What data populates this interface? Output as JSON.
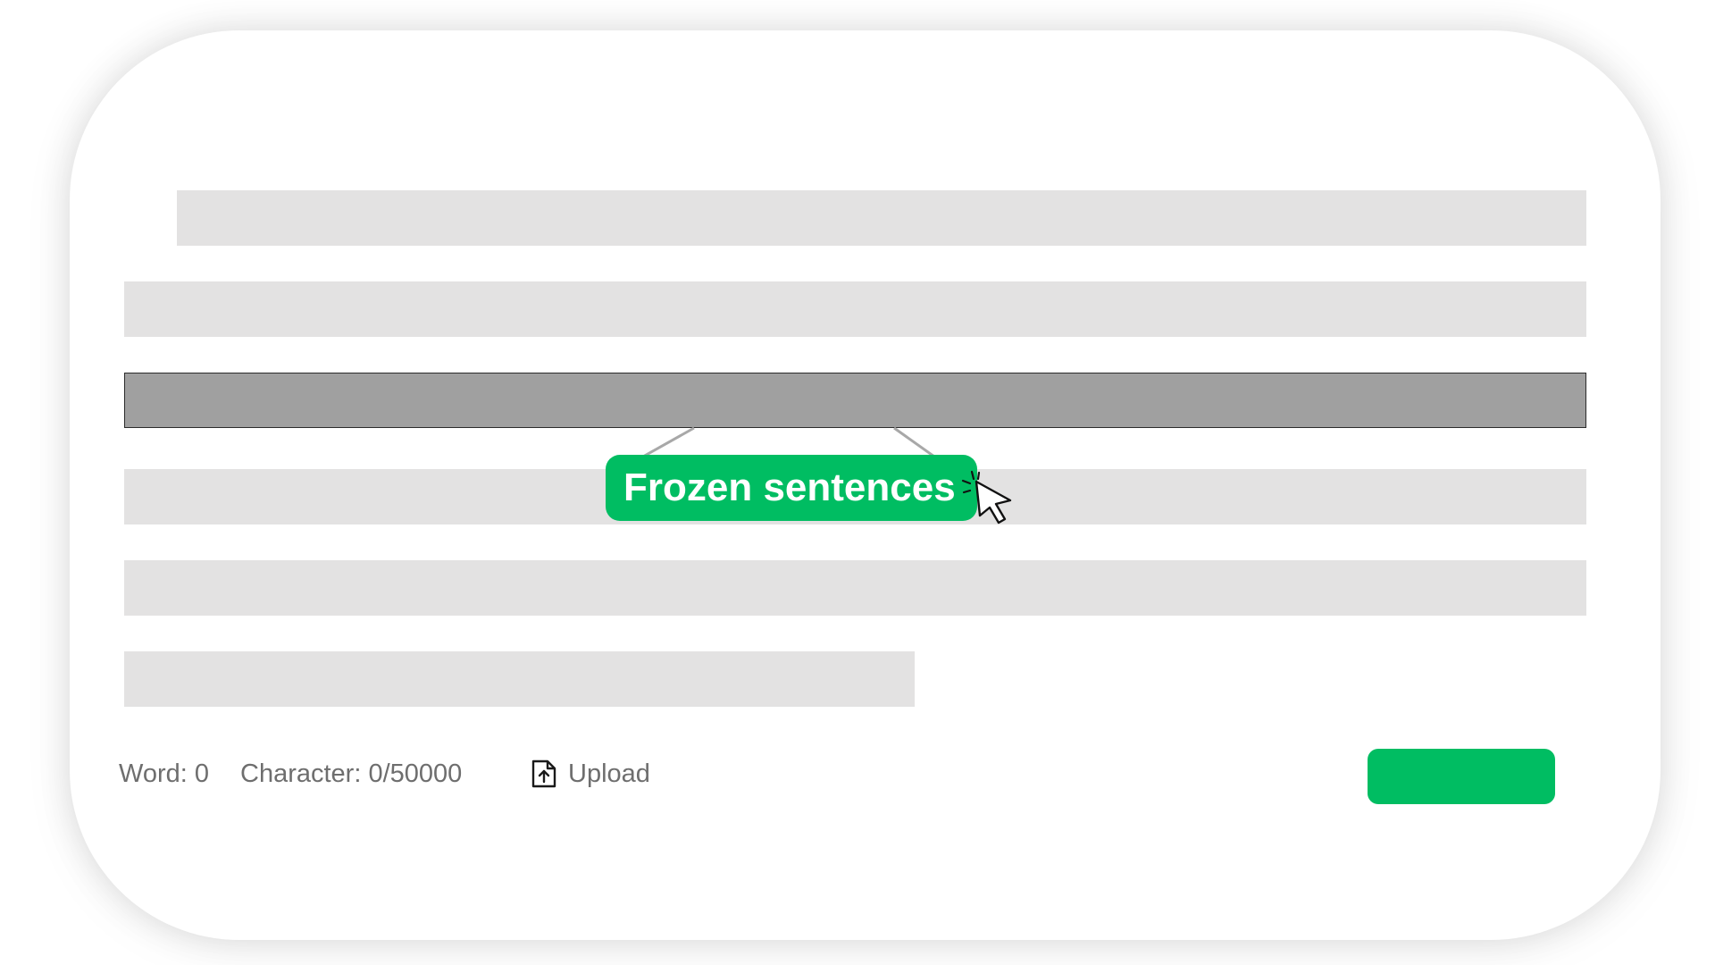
{
  "editor": {
    "lines": [
      {
        "id": "line-1",
        "state": "placeholder"
      },
      {
        "id": "line-2",
        "state": "placeholder"
      },
      {
        "id": "line-3",
        "state": "frozen"
      },
      {
        "id": "line-4",
        "state": "placeholder"
      },
      {
        "id": "line-5",
        "state": "placeholder"
      },
      {
        "id": "line-6",
        "state": "placeholder"
      }
    ]
  },
  "tooltip": {
    "label": "Frozen sentences"
  },
  "footer": {
    "word_count": "Word: 0",
    "char_count": "Character: 0/50000",
    "upload_label": "Upload",
    "upload_icon": "upload-file-icon",
    "submit_label": ""
  },
  "colors": {
    "accent": "#00bd62",
    "placeholder_line": "#e3e2e2",
    "frozen_line": "#a0a0a0",
    "muted_text": "#6e6e6e"
  }
}
